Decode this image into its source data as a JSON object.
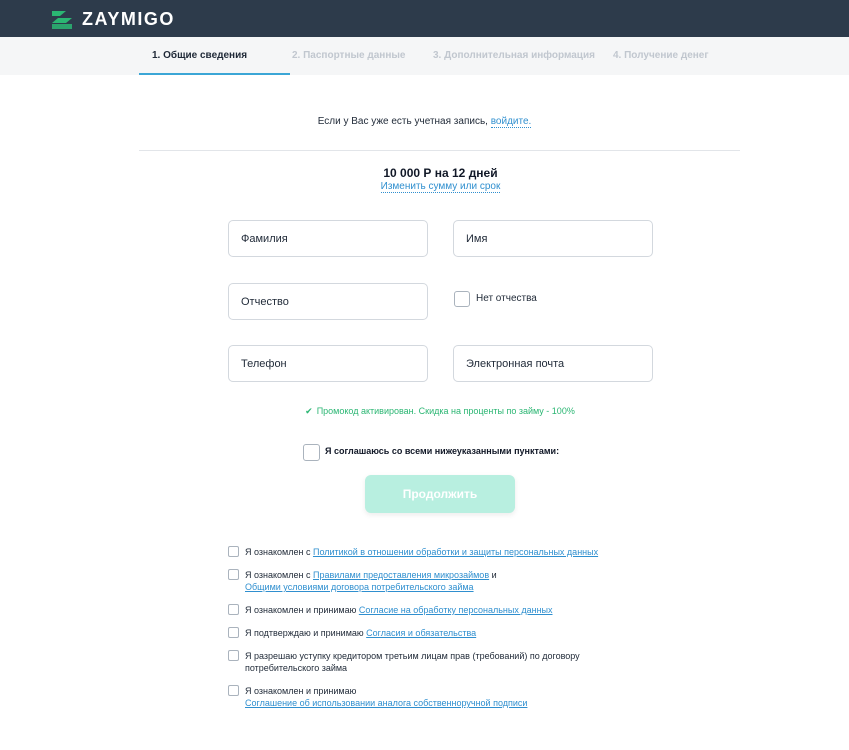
{
  "header": {
    "brand": "ZAYMIGO",
    "colors": {
      "bar": "#2d3b4b",
      "logo_green": "#2bb673"
    }
  },
  "steps": [
    {
      "label": "1. Общие сведения",
      "active": true
    },
    {
      "label": "2. Паспортные данные",
      "active": false
    },
    {
      "label": "3. Дополнительная информация",
      "active": false
    },
    {
      "label": "4. Получение денег",
      "active": false
    }
  ],
  "login_hint": {
    "text": "Если у Вас уже есть учетная запись, ",
    "link": "войдите."
  },
  "loan": {
    "summary": "10 000 Р на 12 дней",
    "change_link": "Изменить сумму или срок"
  },
  "form": {
    "surname_placeholder": "Фамилия",
    "name_placeholder": "Имя",
    "patronymic_placeholder": "Отчество",
    "no_patronymic_label": "Нет отчества",
    "phone_placeholder": "Телефон",
    "email_placeholder": "Электронная почта"
  },
  "promo": {
    "icon": "check-icon",
    "text": "Промокод активирован. Скидка на проценты по займу - 100%",
    "color": "#2bb673"
  },
  "agree_all_label": "Я соглашаюсь со всеми нижеуказанными пунктами:",
  "continue_label": "Продолжить",
  "consents": [
    {
      "pre": "Я ознакомлен с ",
      "link": "Политикой в отношении обработки и защиты персональных данных"
    },
    {
      "pre": "Я ознакомлен с ",
      "link": "Правилами предоставления микрозаймов",
      "mid": " и",
      "link2": "Общими условиями договора потребительского займа"
    },
    {
      "pre": "Я ознакомлен и принимаю ",
      "link": "Согласие на обработку персональных данных"
    },
    {
      "pre": "Я подтверждаю и принимаю ",
      "link": "Согласия и обязательства"
    },
    {
      "line1": "Я разрешаю уступку кредитором третьим лицам прав (требований) по договору",
      "line2": "потребительского займа"
    },
    {
      "pre": "Я ознакомлен и принимаю",
      "link": "Соглашение об использовании аналога собственноручной подписи"
    }
  ]
}
